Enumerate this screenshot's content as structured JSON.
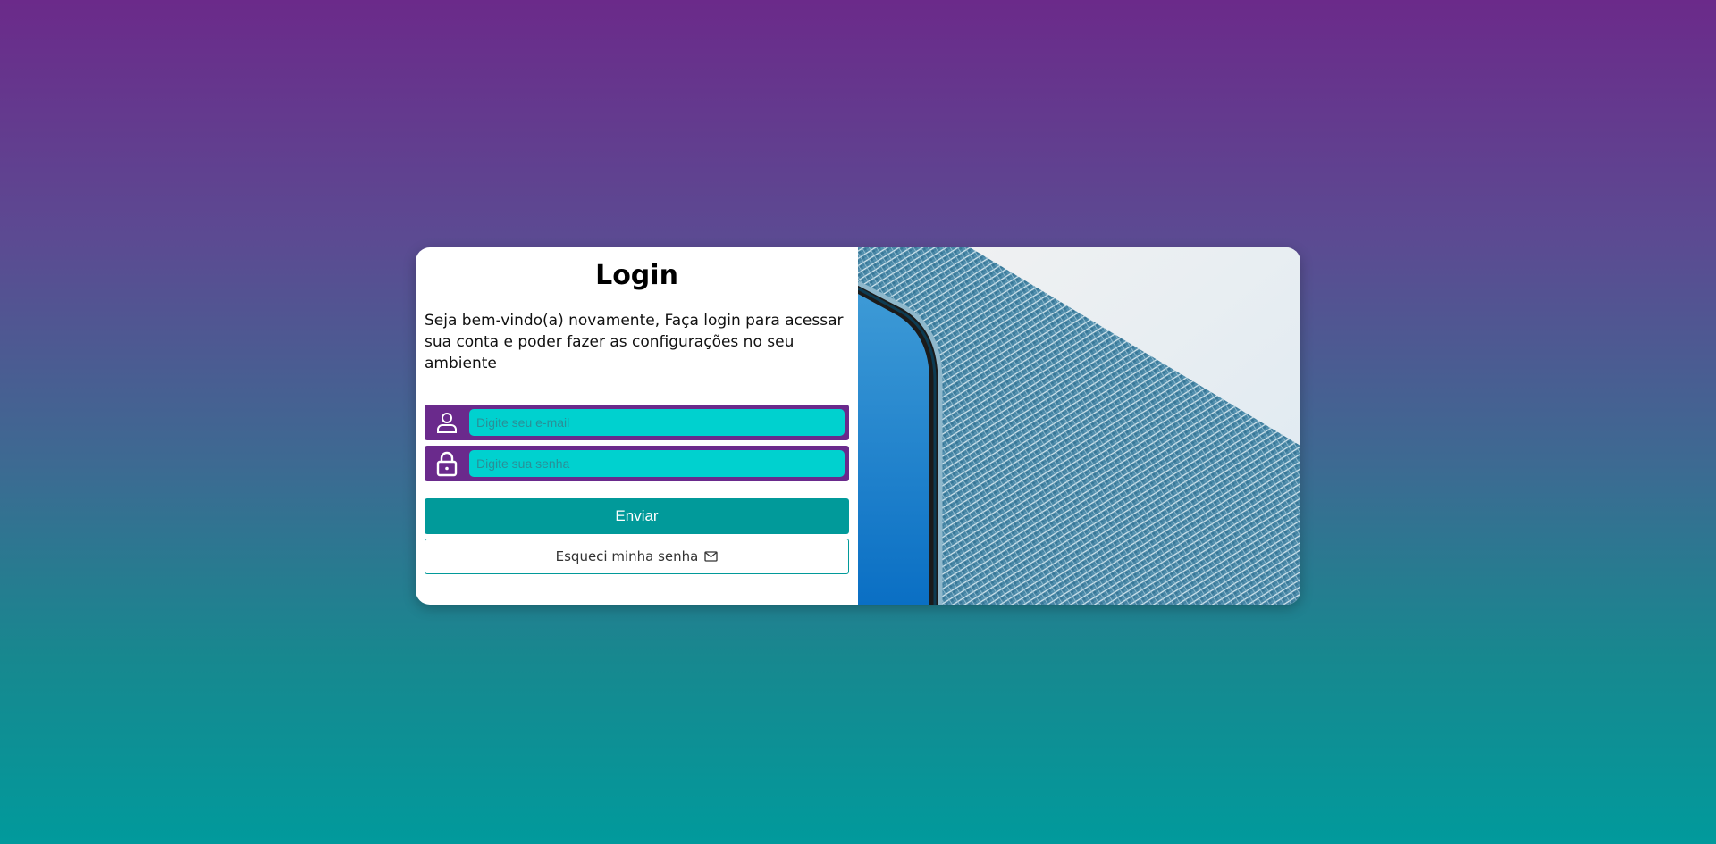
{
  "login": {
    "title": "Login",
    "welcome_text": "Seja bem-vindo(a) novamente, Faça login para acessar sua conta e poder fazer as configurações no seu ambiente",
    "email": {
      "value": "",
      "placeholder": "Digite seu e-mail",
      "icon": "user-icon"
    },
    "password": {
      "value": "",
      "placeholder": "Digite sua senha",
      "icon": "lock-icon"
    },
    "submit_label": "Enviar",
    "forgot_label": "Esqueci minha senha",
    "forgot_icon": "mail-icon"
  },
  "hero_image": {
    "subject": "building-facade-photo"
  },
  "colors": {
    "bg_top": "#6b2a8a",
    "bg_bottom": "#019a9c",
    "field_bg": "#6a2a8c",
    "input_bg": "#00d1cf",
    "accent": "#019a9a"
  }
}
